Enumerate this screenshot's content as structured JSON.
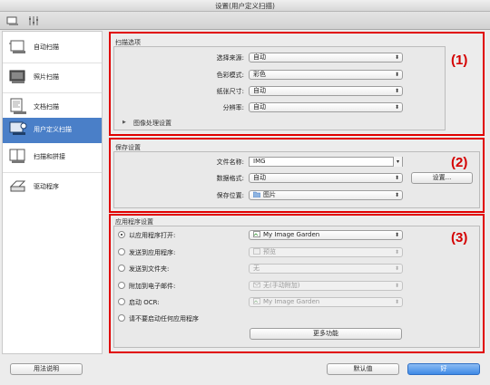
{
  "window": {
    "title": "设置(用户定义扫描)"
  },
  "toolbar": {
    "icons": [
      "scan-from-computer-icon",
      "general-settings-icon"
    ]
  },
  "sidebar": {
    "items": [
      {
        "label": "自动扫描",
        "icon": "auto-scan-icon",
        "active": false
      },
      {
        "label": "照片扫描",
        "icon": "photo-scan-icon",
        "active": false
      },
      {
        "label": "文档扫描",
        "icon": "document-scan-icon",
        "active": false
      },
      {
        "label": "用户定义扫描",
        "icon": "custom-scan-icon",
        "active": true
      },
      {
        "label": "扫描和拼接",
        "icon": "scan-stitch-icon",
        "active": false
      },
      {
        "label": "驱动程序",
        "icon": "driver-icon",
        "active": false
      }
    ]
  },
  "scan_options": {
    "title": "扫描选项",
    "marker": "(1)",
    "source_label": "选择来源:",
    "source_value": "自动",
    "color_label": "色彩模式:",
    "color_value": "彩色",
    "paper_label": "纸张尺寸:",
    "paper_value": "自动",
    "resolution_label": "分辨率:",
    "resolution_value": "自动",
    "image_processing_label": "图像处理设置"
  },
  "save_settings": {
    "title": "保存设置",
    "marker": "(2)",
    "filename_label": "文件名称:",
    "filename_value": "IMG",
    "format_label": "数据格式:",
    "format_value": "自动",
    "format_settings_button": "设置...",
    "location_label": "保存位置:",
    "location_value": "图片"
  },
  "app_settings": {
    "title": "应用程序设置",
    "marker": "(3)",
    "options": [
      {
        "label": "以应用程序打开:",
        "value": "My Image Garden",
        "checked": true,
        "enabled": true
      },
      {
        "label": "发送到应用程序:",
        "value": "预览",
        "checked": false,
        "enabled": false
      },
      {
        "label": "发送到文件夹:",
        "value": "无",
        "checked": false,
        "enabled": false
      },
      {
        "label": "附加到电子邮件:",
        "value": "无(手动附加)",
        "checked": false,
        "enabled": false
      },
      {
        "label": "启动 OCR:",
        "value": "My Image Garden",
        "checked": false,
        "enabled": false
      },
      {
        "label": "请不要启动任何应用程序",
        "checked": false
      }
    ],
    "more_functions_button": "更多功能"
  },
  "footer": {
    "help_button": "用法说明",
    "defaults_button": "默认值",
    "ok_button": "好"
  },
  "colors": {
    "accent": "#4a7fc8",
    "highlight_box": "#e00000",
    "default_button": "#3e8ae6"
  }
}
